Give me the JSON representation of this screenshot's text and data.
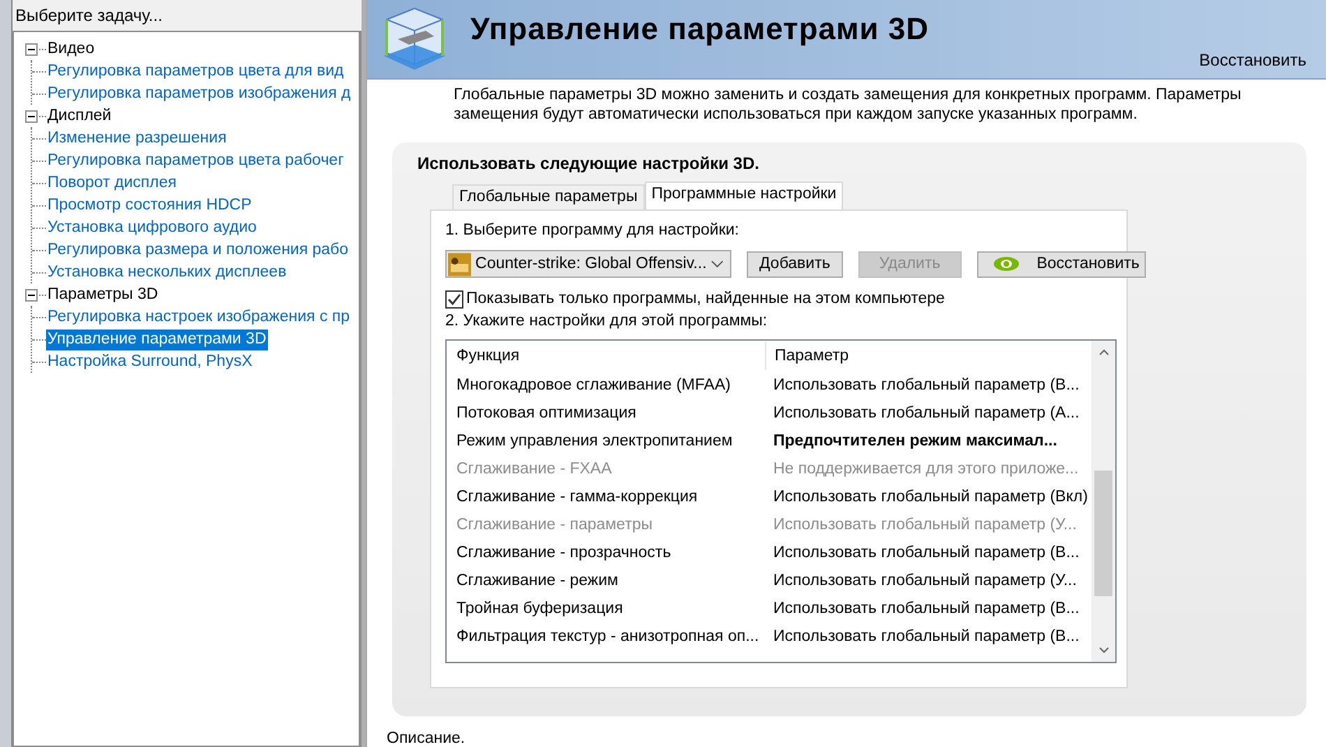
{
  "sidebar": {
    "title": "Выберите задачу...",
    "tree": [
      {
        "label": "Видео",
        "expanded": true,
        "children": [
          {
            "label": "Регулировка параметров цвета для вид",
            "selected": false
          },
          {
            "label": "Регулировка параметров изображения д",
            "selected": false
          }
        ]
      },
      {
        "label": "Дисплей",
        "expanded": true,
        "children": [
          {
            "label": "Изменение разрешения",
            "selected": false
          },
          {
            "label": "Регулировка параметров цвета рабочег",
            "selected": false
          },
          {
            "label": "Поворот дисплея",
            "selected": false
          },
          {
            "label": "Просмотр состояния HDCP",
            "selected": false
          },
          {
            "label": "Установка цифрового аудио",
            "selected": false
          },
          {
            "label": "Регулировка размера и положения рабо",
            "selected": false
          },
          {
            "label": "Установка нескольких дисплеев",
            "selected": false
          }
        ]
      },
      {
        "label": "Параметры 3D",
        "expanded": true,
        "children": [
          {
            "label": "Регулировка настроек изображения с пр",
            "selected": false
          },
          {
            "label": "Управление параметрами 3D",
            "selected": true
          },
          {
            "label": "Настройка Surround, PhysX",
            "selected": false
          }
        ]
      }
    ]
  },
  "header": {
    "title": "Управление параметрами 3D",
    "restore_link": "Восстановить"
  },
  "intro": "Глобальные параметры 3D можно заменить и создать замещения для конкретных программ. Параметры замещения будут автоматически использоваться при каждом запуске указанных программ.",
  "panel": {
    "heading": "Использовать следующие настройки 3D.",
    "tabs": [
      {
        "label": "Глобальные параметры",
        "selected": false
      },
      {
        "label": "Программные настройки",
        "selected": true
      }
    ],
    "step1": "1. Выберите программу для настройки:",
    "program": {
      "value": "Counter-strike: Global Offensiv..."
    },
    "buttons": [
      {
        "label": "Добавить",
        "disabled": false,
        "kind": "plain"
      },
      {
        "label": "Удалить",
        "disabled": true,
        "kind": "plain"
      },
      {
        "label": "Восстановить",
        "disabled": false,
        "kind": "logo"
      }
    ],
    "checkbox": {
      "label": "Показывать только программы, найденные на этом компьютере",
      "checked": true
    },
    "step2": "2. Укажите настройки для этой программы:",
    "table": {
      "columns": [
        "Функция",
        "Параметр"
      ],
      "rows": [
        {
          "function": "Многокадровое сглаживание (MFAA)",
          "parameter": "Использовать глобальный параметр (В...",
          "disabled": false,
          "emphasis": false
        },
        {
          "function": "Потоковая оптимизация",
          "parameter": "Использовать глобальный параметр (А...",
          "disabled": false,
          "emphasis": false
        },
        {
          "function": "Режим управления электропитанием",
          "parameter": "Предпочтителен режим максимал...",
          "disabled": false,
          "emphasis": true
        },
        {
          "function": "Сглаживание - FXAA",
          "parameter": "Не поддерживается для этого приложе...",
          "disabled": true,
          "emphasis": false
        },
        {
          "function": "Сглаживание - гамма-коррекция",
          "parameter": "Использовать глобальный параметр (Вкл)",
          "disabled": false,
          "emphasis": false
        },
        {
          "function": "Сглаживание - параметры",
          "parameter": "Использовать глобальный параметр (У...",
          "disabled": true,
          "emphasis": false
        },
        {
          "function": "Сглаживание - прозрачность",
          "parameter": "Использовать глобальный параметр (В...",
          "disabled": false,
          "emphasis": false
        },
        {
          "function": "Сглаживание - режим",
          "parameter": "Использовать глобальный параметр (У...",
          "disabled": false,
          "emphasis": false
        },
        {
          "function": "Тройная буферизация",
          "parameter": "Использовать глобальный параметр (В...",
          "disabled": false,
          "emphasis": false
        },
        {
          "function": "Фильтрация текстур - анизотропная оп...",
          "parameter": "Использовать глобальный параметр (В...",
          "disabled": false,
          "emphasis": false
        }
      ]
    }
  },
  "description_label": "Описание."
}
